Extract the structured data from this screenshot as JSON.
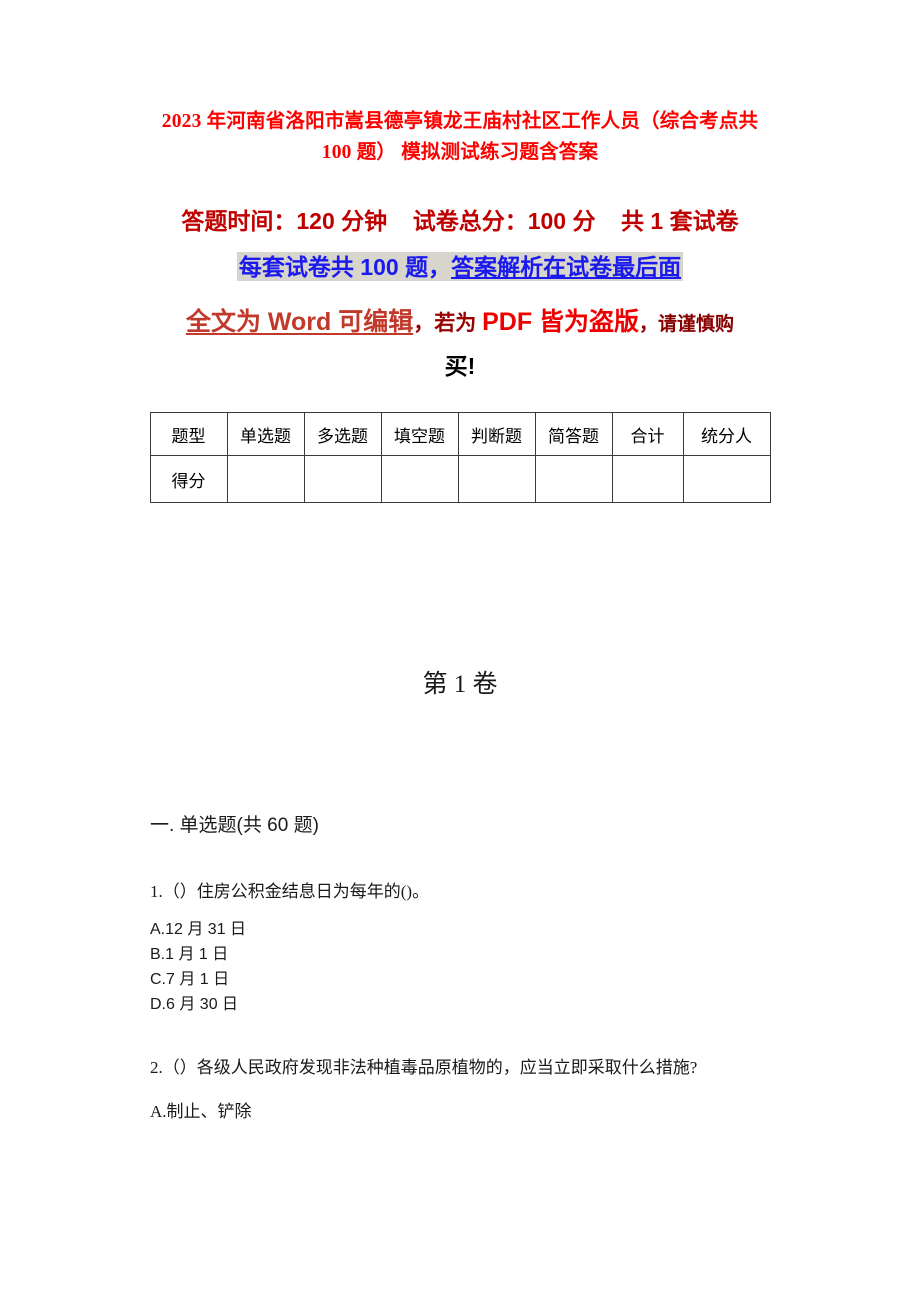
{
  "document": {
    "title_line1": "2023 年河南省洛阳市嵩县德亭镇龙王庙村社区工作人员（综合考点共 100 题）",
    "title_line2": "模拟测试练习题含答案",
    "info_line": "答题时间：120 分钟    试卷总分：100 分    共 1 套试卷",
    "blue_line_part1": "每套试卷共 100 题，",
    "blue_line_part2": "答案解析在试卷最后面",
    "warning_part1": "全文为 Word 可编辑",
    "warning_part2": "，若为 ",
    "warning_part3": "PDF 皆为盗版",
    "warning_part4": "，请谨慎购",
    "warning_part5": "买!",
    "volume_heading": "第 1 卷"
  },
  "score_table": {
    "headers": [
      "题型",
      "单选题",
      "多选题",
      "填空题",
      "判断题",
      "简答题",
      "合计",
      "统分人"
    ],
    "row_label": "得分",
    "row_values": [
      "",
      "",
      "",
      "",
      "",
      "",
      ""
    ]
  },
  "sections": [
    {
      "heading": "一. 单选题(共 60 题)",
      "questions": [
        {
          "number": "1.",
          "text": "1.（）住房公积金结息日为每年的()。",
          "options": [
            "A.12 月 31 日",
            "B.1 月 1 日",
            "C.7 月 1 日",
            "D.6 月 30 日"
          ]
        },
        {
          "number": "2.",
          "text": "2.（）各级人民政府发现非法种植毒品原植物的，应当立即采取什么措施?",
          "options": [
            "A.制止、铲除"
          ]
        }
      ]
    }
  ],
  "colors": {
    "title_red": "#ff0000",
    "info_red": "#c00000",
    "blue_text": "#1a1aee",
    "highlight_bg": "#d8d5cd",
    "warn_orange_red": "#c0392b",
    "warn_bright_red": "#ee0000",
    "table_border": "#3b3b3b"
  }
}
